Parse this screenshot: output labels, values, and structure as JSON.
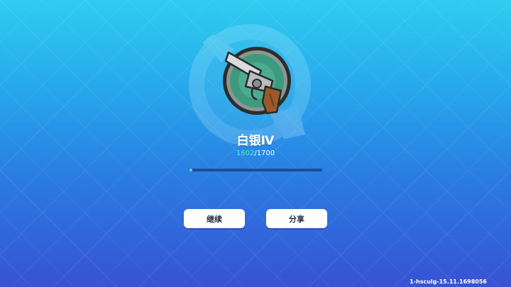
{
  "rank": {
    "name": "白银Ⅳ",
    "current_points": "1602",
    "max_points": "1700",
    "progress_fraction": 0.02
  },
  "buttons": {
    "continue_label": "继续",
    "share_label": "分享"
  },
  "footer": {
    "version": "1-hsculg-15.11.1698056"
  },
  "icons": {
    "badge": "revolver-icon"
  },
  "colors": {
    "bg_top": "#2fcdf0",
    "bg_bottom": "#3852d3",
    "progress_current": "#4cf0c4",
    "badge_ring": "#2c2c2c",
    "badge_center": "#3e9a7e"
  }
}
